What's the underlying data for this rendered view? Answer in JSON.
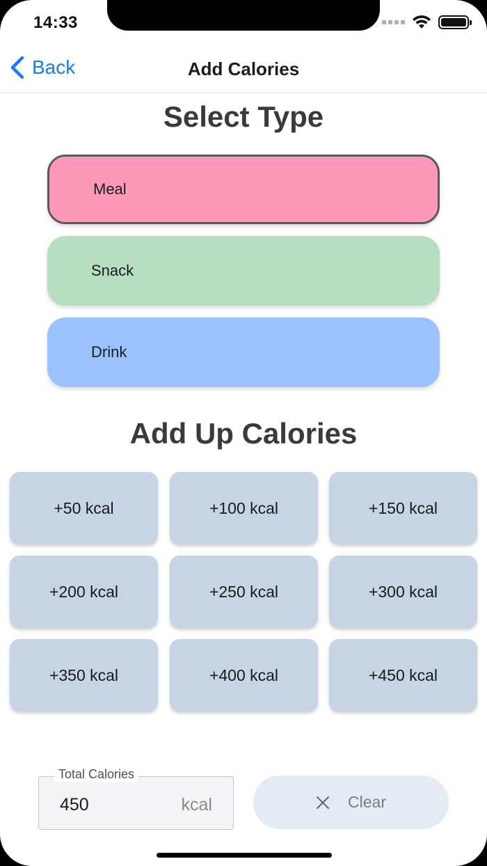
{
  "status_bar": {
    "time": "14:33"
  },
  "nav": {
    "back_label": "Back",
    "title": "Add Calories"
  },
  "select_type": {
    "heading": "Select Type",
    "options": [
      {
        "label": "Meal",
        "color": "#fd98b9",
        "selected": true
      },
      {
        "label": "Snack",
        "color": "#b7dec1",
        "selected": false
      },
      {
        "label": "Drink",
        "color": "#9bc2fe",
        "selected": false
      }
    ]
  },
  "add_up": {
    "heading": "Add Up Calories",
    "buttons": [
      "+50 kcal",
      "+100 kcal",
      "+150 kcal",
      "+200 kcal",
      "+250 kcal",
      "+300 kcal",
      "+350 kcal",
      "+400 kcal",
      "+450 kcal"
    ]
  },
  "total": {
    "label": "Total Calories",
    "value": "450",
    "unit": "kcal"
  },
  "clear_button": {
    "label": "Clear"
  },
  "colors": {
    "accent": "#1a7cf2",
    "kcal_button": "#c6d4e4",
    "clear_button": "#e4ebf4"
  }
}
